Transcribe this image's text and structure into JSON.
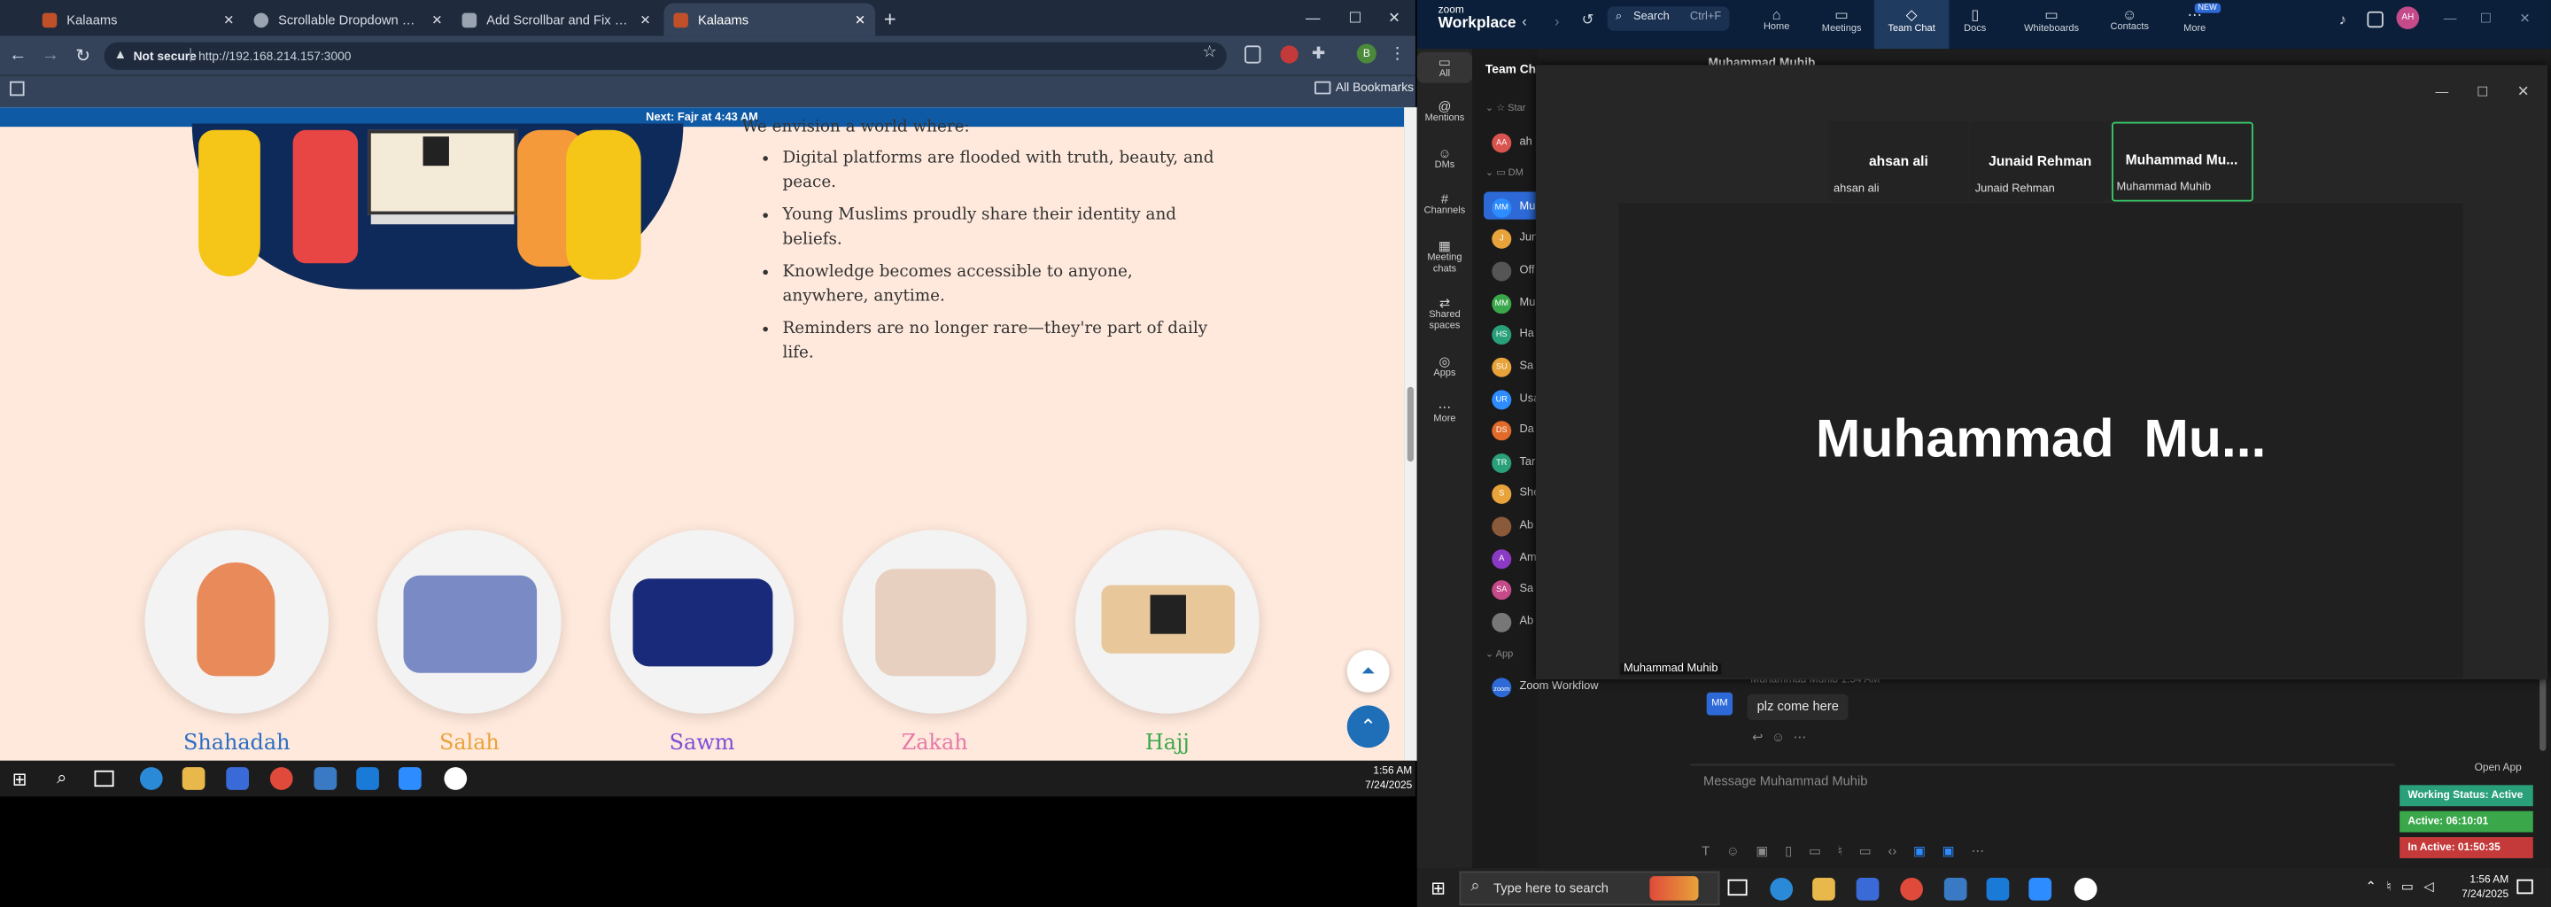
{
  "browser": {
    "tabs": [
      {
        "title": "Kalaams",
        "active": false
      },
      {
        "title": "Scrollable Dropdown Mobile Fri",
        "active": false
      },
      {
        "title": "Add Scrollbar and Fix Height fo",
        "active": false
      },
      {
        "title": "Kalaams",
        "active": true
      }
    ],
    "security_label": "Not secure",
    "url": "http://192.168.214.157:3000",
    "bookmarks_label": "All Bookmarks",
    "profile_initial": "B"
  },
  "page": {
    "notice": "Next: Fajr at 4:43 AM",
    "intro": "We envision a world where:",
    "bullets": [
      "Digital platforms are flooded with truth, beauty, and peace.",
      "Young Muslims proudly share their identity and beliefs.",
      "Knowledge becomes accessible to anyone, anywhere, anytime.",
      "Reminders are no longer rare—they're part of daily life."
    ],
    "pillars": [
      {
        "name": "Shahadah",
        "color": "#2a6fc4"
      },
      {
        "name": "Salah",
        "color": "#e8a33a"
      },
      {
        "name": "Sawm",
        "color": "#7b4fd8"
      },
      {
        "name": "Zakah",
        "color": "#e57aa8"
      },
      {
        "name": "Hajj",
        "color": "#3aa84a"
      }
    ]
  },
  "taskbar_left": {
    "time": "1:56 AM",
    "date": "7/24/2025"
  },
  "zoom": {
    "brand_top": "zoom",
    "brand_bottom": "Workplace",
    "search_label": "Search",
    "search_shortcut": "Ctrl+F",
    "nav": [
      {
        "label": "Home",
        "icon": "home-icon"
      },
      {
        "label": "Meetings",
        "icon": "video-icon"
      },
      {
        "label": "Team Chat",
        "icon": "chat-icon"
      },
      {
        "label": "Docs",
        "icon": "doc-icon"
      },
      {
        "label": "Whiteboards",
        "icon": "whiteboard-icon"
      },
      {
        "label": "Contacts",
        "icon": "contacts-icon"
      },
      {
        "label": "More",
        "icon": "more-icon"
      }
    ],
    "new_badge": "NEW",
    "avatar_initials": "AH",
    "left_nav": [
      "All",
      "Mentions",
      "DMs",
      "Channels",
      "Meeting chats",
      "Shared spaces",
      "Apps",
      "More"
    ],
    "panel_title": "Team Ch",
    "section_starred": "Star",
    "section_dms": "DM",
    "section_apps": "App",
    "dm_avatars": [
      {
        "init": "AA",
        "color": "#d9534f",
        "label": "ah"
      },
      {
        "init": "MM",
        "color": "#2d8cff",
        "label": "Mu"
      },
      {
        "init": "J",
        "color": "#e8a33a",
        "label": "Jun"
      },
      {
        "init": "",
        "color": "#555",
        "label": "Off"
      },
      {
        "init": "MM",
        "color": "#3aa84a",
        "label": "Mu"
      },
      {
        "init": "HS",
        "color": "#2aa07a",
        "label": "Ha"
      },
      {
        "init": "SU",
        "color": "#e8a33a",
        "label": "Sa"
      },
      {
        "init": "UR",
        "color": "#2d8cff",
        "label": "Usa"
      },
      {
        "init": "DS",
        "color": "#e06b2a",
        "label": "Da"
      },
      {
        "init": "TR",
        "color": "#2aa07a",
        "label": "Tar"
      },
      {
        "init": "S",
        "color": "#e8a33a",
        "label": "She"
      },
      {
        "init": "",
        "color": "#8a5a3a",
        "label": "Ab"
      },
      {
        "init": "A",
        "color": "#8a3ac4",
        "label": "Am"
      },
      {
        "init": "SA",
        "color": "#c44a8a",
        "label": "Sa"
      },
      {
        "init": "",
        "color": "#777",
        "label": "Ab"
      }
    ],
    "workflow_label": "Zoom Workflow",
    "chat_header": "Muhammad Muhib",
    "message_meta": "Muhammad Muhib 1:54 AM",
    "message_avatar": "MM",
    "message_text": "plz come here",
    "compose_placeholder": "Message Muhammad Muhib",
    "open_app": "Open App",
    "status": [
      {
        "text": "Working Status: Active",
        "color": "#2aa07a"
      },
      {
        "text": "Active: 06:10:01",
        "color": "#3aa84a"
      },
      {
        "text": "In Active: 01:50:35",
        "color": "#c43a3a"
      }
    ],
    "meeting": {
      "tiles": [
        {
          "name": "ahsan ali",
          "caption": "ahsan ali"
        },
        {
          "name": "Junaid Rehman",
          "caption": "Junaid Rehman"
        },
        {
          "name": "Muhammad  Mu...",
          "caption": "Muhammad Muhib"
        }
      ],
      "speaker_big": "Muhammad  Mu...",
      "speaker_caption": "Muhammad Muhib"
    }
  },
  "taskbar_right": {
    "search_placeholder": "Type here to search",
    "time": "1:56 AM",
    "date": "7/24/2025"
  }
}
